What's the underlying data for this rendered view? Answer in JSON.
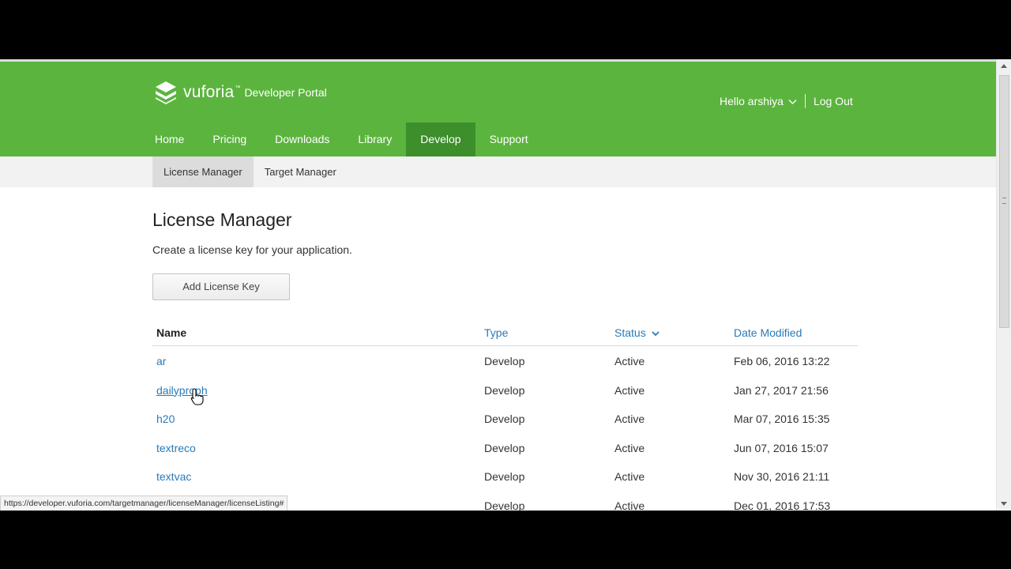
{
  "brand": {
    "name": "vuforia",
    "tm": "™",
    "subtitle": "Developer Portal"
  },
  "user": {
    "greeting": "Hello arshiya",
    "logout": "Log Out"
  },
  "nav": [
    {
      "label": "Home",
      "active": false
    },
    {
      "label": "Pricing",
      "active": false
    },
    {
      "label": "Downloads",
      "active": false
    },
    {
      "label": "Library",
      "active": false
    },
    {
      "label": "Develop",
      "active": true
    },
    {
      "label": "Support",
      "active": false
    }
  ],
  "subnav": [
    {
      "label": "License Manager",
      "active": true
    },
    {
      "label": "Target Manager",
      "active": false
    }
  ],
  "page": {
    "title": "License Manager",
    "description": "Create a license key for your application.",
    "add_button": "Add License Key"
  },
  "table": {
    "headers": {
      "name": "Name",
      "type": "Type",
      "status": "Status",
      "date": "Date Modified"
    },
    "rows": [
      {
        "name": "ar",
        "type": "Develop",
        "status": "Active",
        "date": "Feb 06, 2016 13:22"
      },
      {
        "name": "dailyproph",
        "type": "Develop",
        "status": "Active",
        "date": "Jan 27, 2017 21:56"
      },
      {
        "name": "h20",
        "type": "Develop",
        "status": "Active",
        "date": "Mar 07, 2016 15:35"
      },
      {
        "name": "textreco",
        "type": "Develop",
        "status": "Active",
        "date": "Jun 07, 2016 15:07"
      },
      {
        "name": "textvac",
        "type": "Develop",
        "status": "Active",
        "date": "Nov 30, 2016 21:11"
      },
      {
        "name": "",
        "type": "Develop",
        "status": "Active",
        "date": "Dec 01, 2016 17:53"
      }
    ]
  },
  "statusbar": {
    "url": "https://developer.vuforia.com/targetmanager/licenseManager/licenseListing#"
  },
  "colors": {
    "brand_green": "#5bb43e",
    "nav_active": "#3c8f2a",
    "link_blue": "#2a7ab6"
  }
}
